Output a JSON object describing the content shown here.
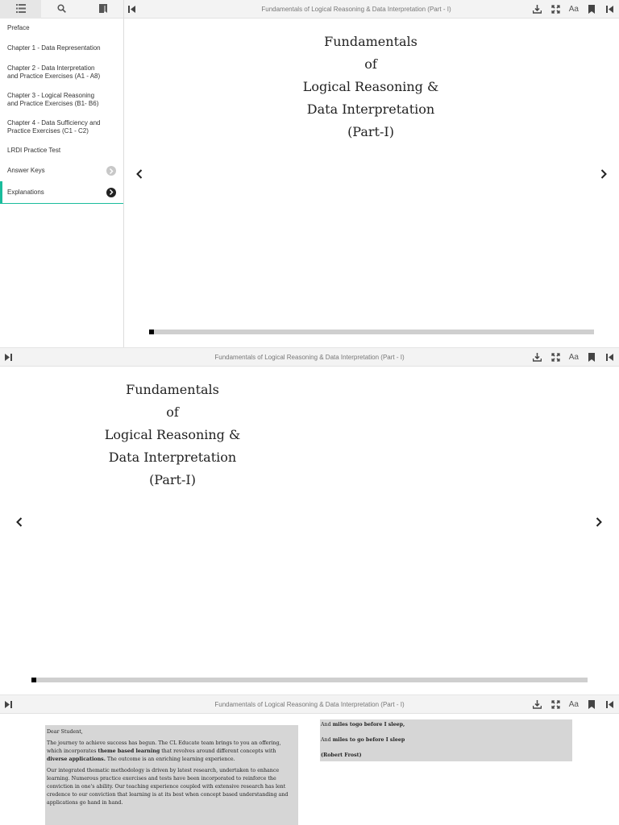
{
  "book_title": "Fundamentals of Logical Reasoning & Data Interpretation (Part - I)",
  "cover_lines": [
    "Fundamentals",
    "of",
    "Logical Reasoning &",
    "Data Interpretation",
    "(Part-I)"
  ],
  "sidebar": {
    "tabs": [
      {
        "name": "toc",
        "icon": "list-icon"
      },
      {
        "name": "search",
        "icon": "search-icon"
      },
      {
        "name": "bookmarks",
        "icon": "bookmark-icon"
      }
    ],
    "items": [
      {
        "label": "Preface"
      },
      {
        "label": "Chapter 1 - Data Representation"
      },
      {
        "label": "Chapter 2 - Data Interpretation and Practice Exercises (A1 - A8)"
      },
      {
        "label": "Chapter 3 - Logical Reasoning and Practice Exercises (B1- B6)"
      },
      {
        "label": "Chapter 4 - Data Sufficiency and Practice Exercises (C1 - C2)"
      },
      {
        "label": "LRDI Practice Test"
      },
      {
        "label": "Answer Keys"
      },
      {
        "label": "Explanations"
      }
    ]
  },
  "toolbar_icons": [
    "download-icon",
    "fullscreen-icon",
    "font-size-icon",
    "bookmark-icon",
    "skip-back-icon"
  ],
  "font_toggle_label": "Aa",
  "letter": {
    "greeting": "Dear Student,",
    "p1_a": "The journey to achieve success has begun. The CL Educate team brings to you an offering, which incorporates ",
    "p1_b": "theme based learning",
    "p1_c": " that revolves around different concepts with ",
    "p1_d": "diverse applications.",
    "p1_e": " The outcome is an enriching learning experience.",
    "p2": "Our integrated thematic methodology is driven by latest research, undertaken to enhance learning. Numerous practice exercises and tests have been incorporated to reinforce the conviction in one's ability. Our teaching experience coupled with extensive research has lent credence to our conviction that learning is at its best when concept based understanding and applications go hand in hand."
  },
  "poem": {
    "line1_a": "And ",
    "line1_b": "miles togo before I sleep,",
    "line2_a": "And ",
    "line2_b": "miles to go before I sleep",
    "author": "(Robert Frost)"
  },
  "colors": {
    "accent": "#1abc9c",
    "toolbar_bg": "#f3f3f3",
    "progress_track": "#cfcfcf"
  },
  "reading_progress": 0.01
}
